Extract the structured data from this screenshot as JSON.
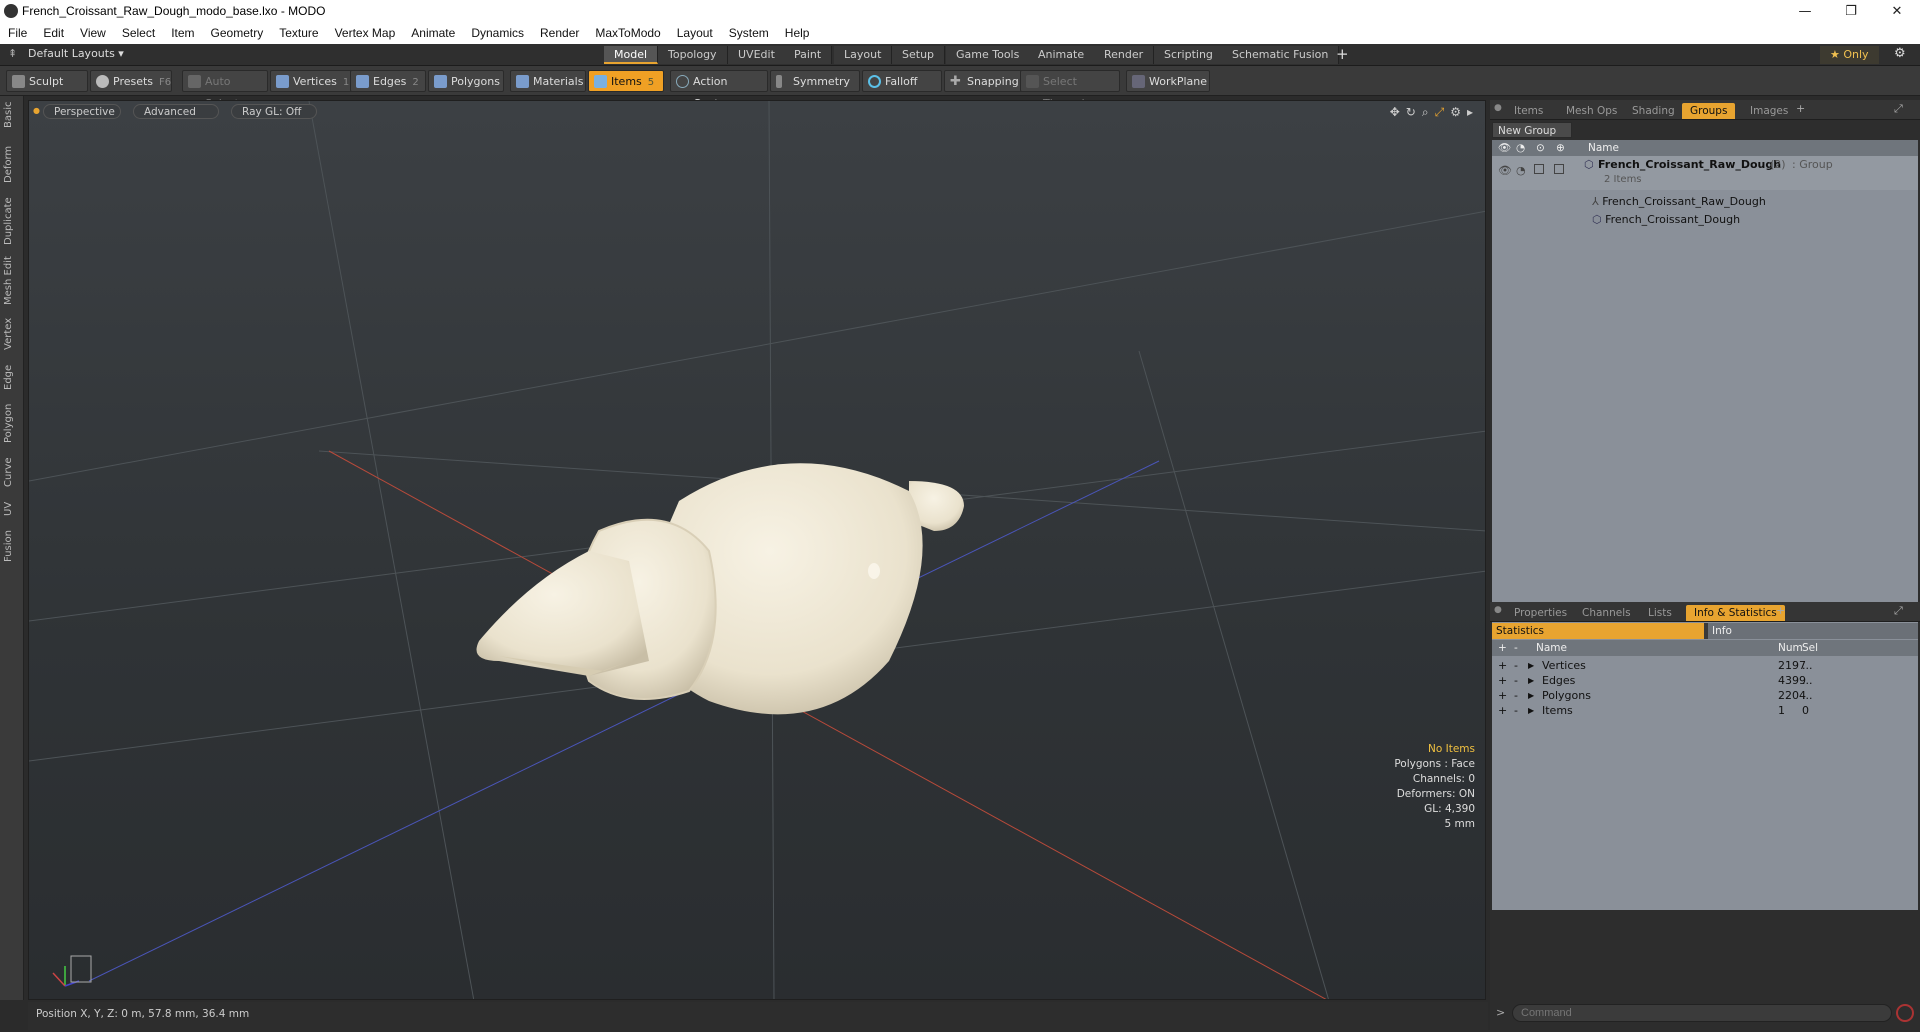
{
  "window": {
    "title": "French_Croissant_Raw_Dough_modo_base.lxo - MODO"
  },
  "menu": [
    "File",
    "Edit",
    "View",
    "Select",
    "Item",
    "Geometry",
    "Texture",
    "Vertex Map",
    "Animate",
    "Dynamics",
    "Render",
    "MaxToModo",
    "Layout",
    "System",
    "Help"
  ],
  "layout_selector": "Default Layouts ▾",
  "mode_tabs": [
    "Model",
    "Topology",
    "UVEdit",
    "Paint",
    "Layout",
    "Setup",
    "Game Tools",
    "Animate",
    "Render",
    "Scripting",
    "Schematic Fusion"
  ],
  "only_label": "★  Only",
  "toolbar": {
    "sculpt": "Sculpt",
    "presets": "Presets",
    "presets_key": "F6",
    "auto_select": "Auto Select",
    "vertices": "Vertices",
    "vertices_key": "1",
    "edges": "Edges",
    "edges_key": "2",
    "polygons": "Polygons",
    "materials": "Materials",
    "items": "Items",
    "items_key": "5",
    "action_center": "Action Center",
    "symmetry": "Symmetry",
    "falloff": "Falloff",
    "snapping": "Snapping",
    "select_through": "Select Through",
    "workplane": "WorkPlane"
  },
  "left_tabs": [
    "Basic",
    "Deform",
    "Duplicate",
    "Mesh Edit",
    "Vertex",
    "Edge",
    "Polygon",
    "Curve",
    "UV",
    "Fusion"
  ],
  "viewport": {
    "view": "Perspective",
    "shading": "Advanced",
    "raygl": "Ray GL: Off",
    "stats": {
      "selection": "No Items",
      "polygons": "Polygons : Face",
      "channels": "Channels: 0",
      "deformers": "Deformers: ON",
      "gl": "GL: 4,390",
      "scale": "5 mm"
    }
  },
  "status_bar": "Position X, Y, Z:   0 m, 57.8 mm, 36.4 mm",
  "top_panel": {
    "tabs": [
      "Items",
      "Mesh Ops",
      "Shading",
      "Groups",
      "Images"
    ],
    "active_tab": "Groups",
    "new_group": "New Group",
    "col_name": "Name",
    "group": {
      "name": "French_Croissant_Raw_Dough",
      "count": "(2)",
      "type": ": Group",
      "sub": "2 Items"
    },
    "children": [
      "French_Croissant_Raw_Dough",
      "French_Croissant_Dough"
    ]
  },
  "bottom_panel": {
    "tabs": [
      "Properties",
      "Channels",
      "Lists",
      "Info & Statistics"
    ],
    "active_tab": "Info & Statistics",
    "subtabs": [
      "Statistics",
      "Info"
    ],
    "columns": {
      "name": "Name",
      "num": "Num",
      "sel": "Sel"
    },
    "rows": [
      {
        "name": "Vertices",
        "num": "2197",
        "sel": "..."
      },
      {
        "name": "Edges",
        "num": "4399",
        "sel": "..."
      },
      {
        "name": "Polygons",
        "num": "2204",
        "sel": "..."
      },
      {
        "name": "Items",
        "num": "1",
        "sel": "0"
      }
    ]
  },
  "command_placeholder": "Command",
  "colors": {
    "accent": "#e8a430",
    "panel": "#8a9099",
    "viewport": "#33373a"
  }
}
